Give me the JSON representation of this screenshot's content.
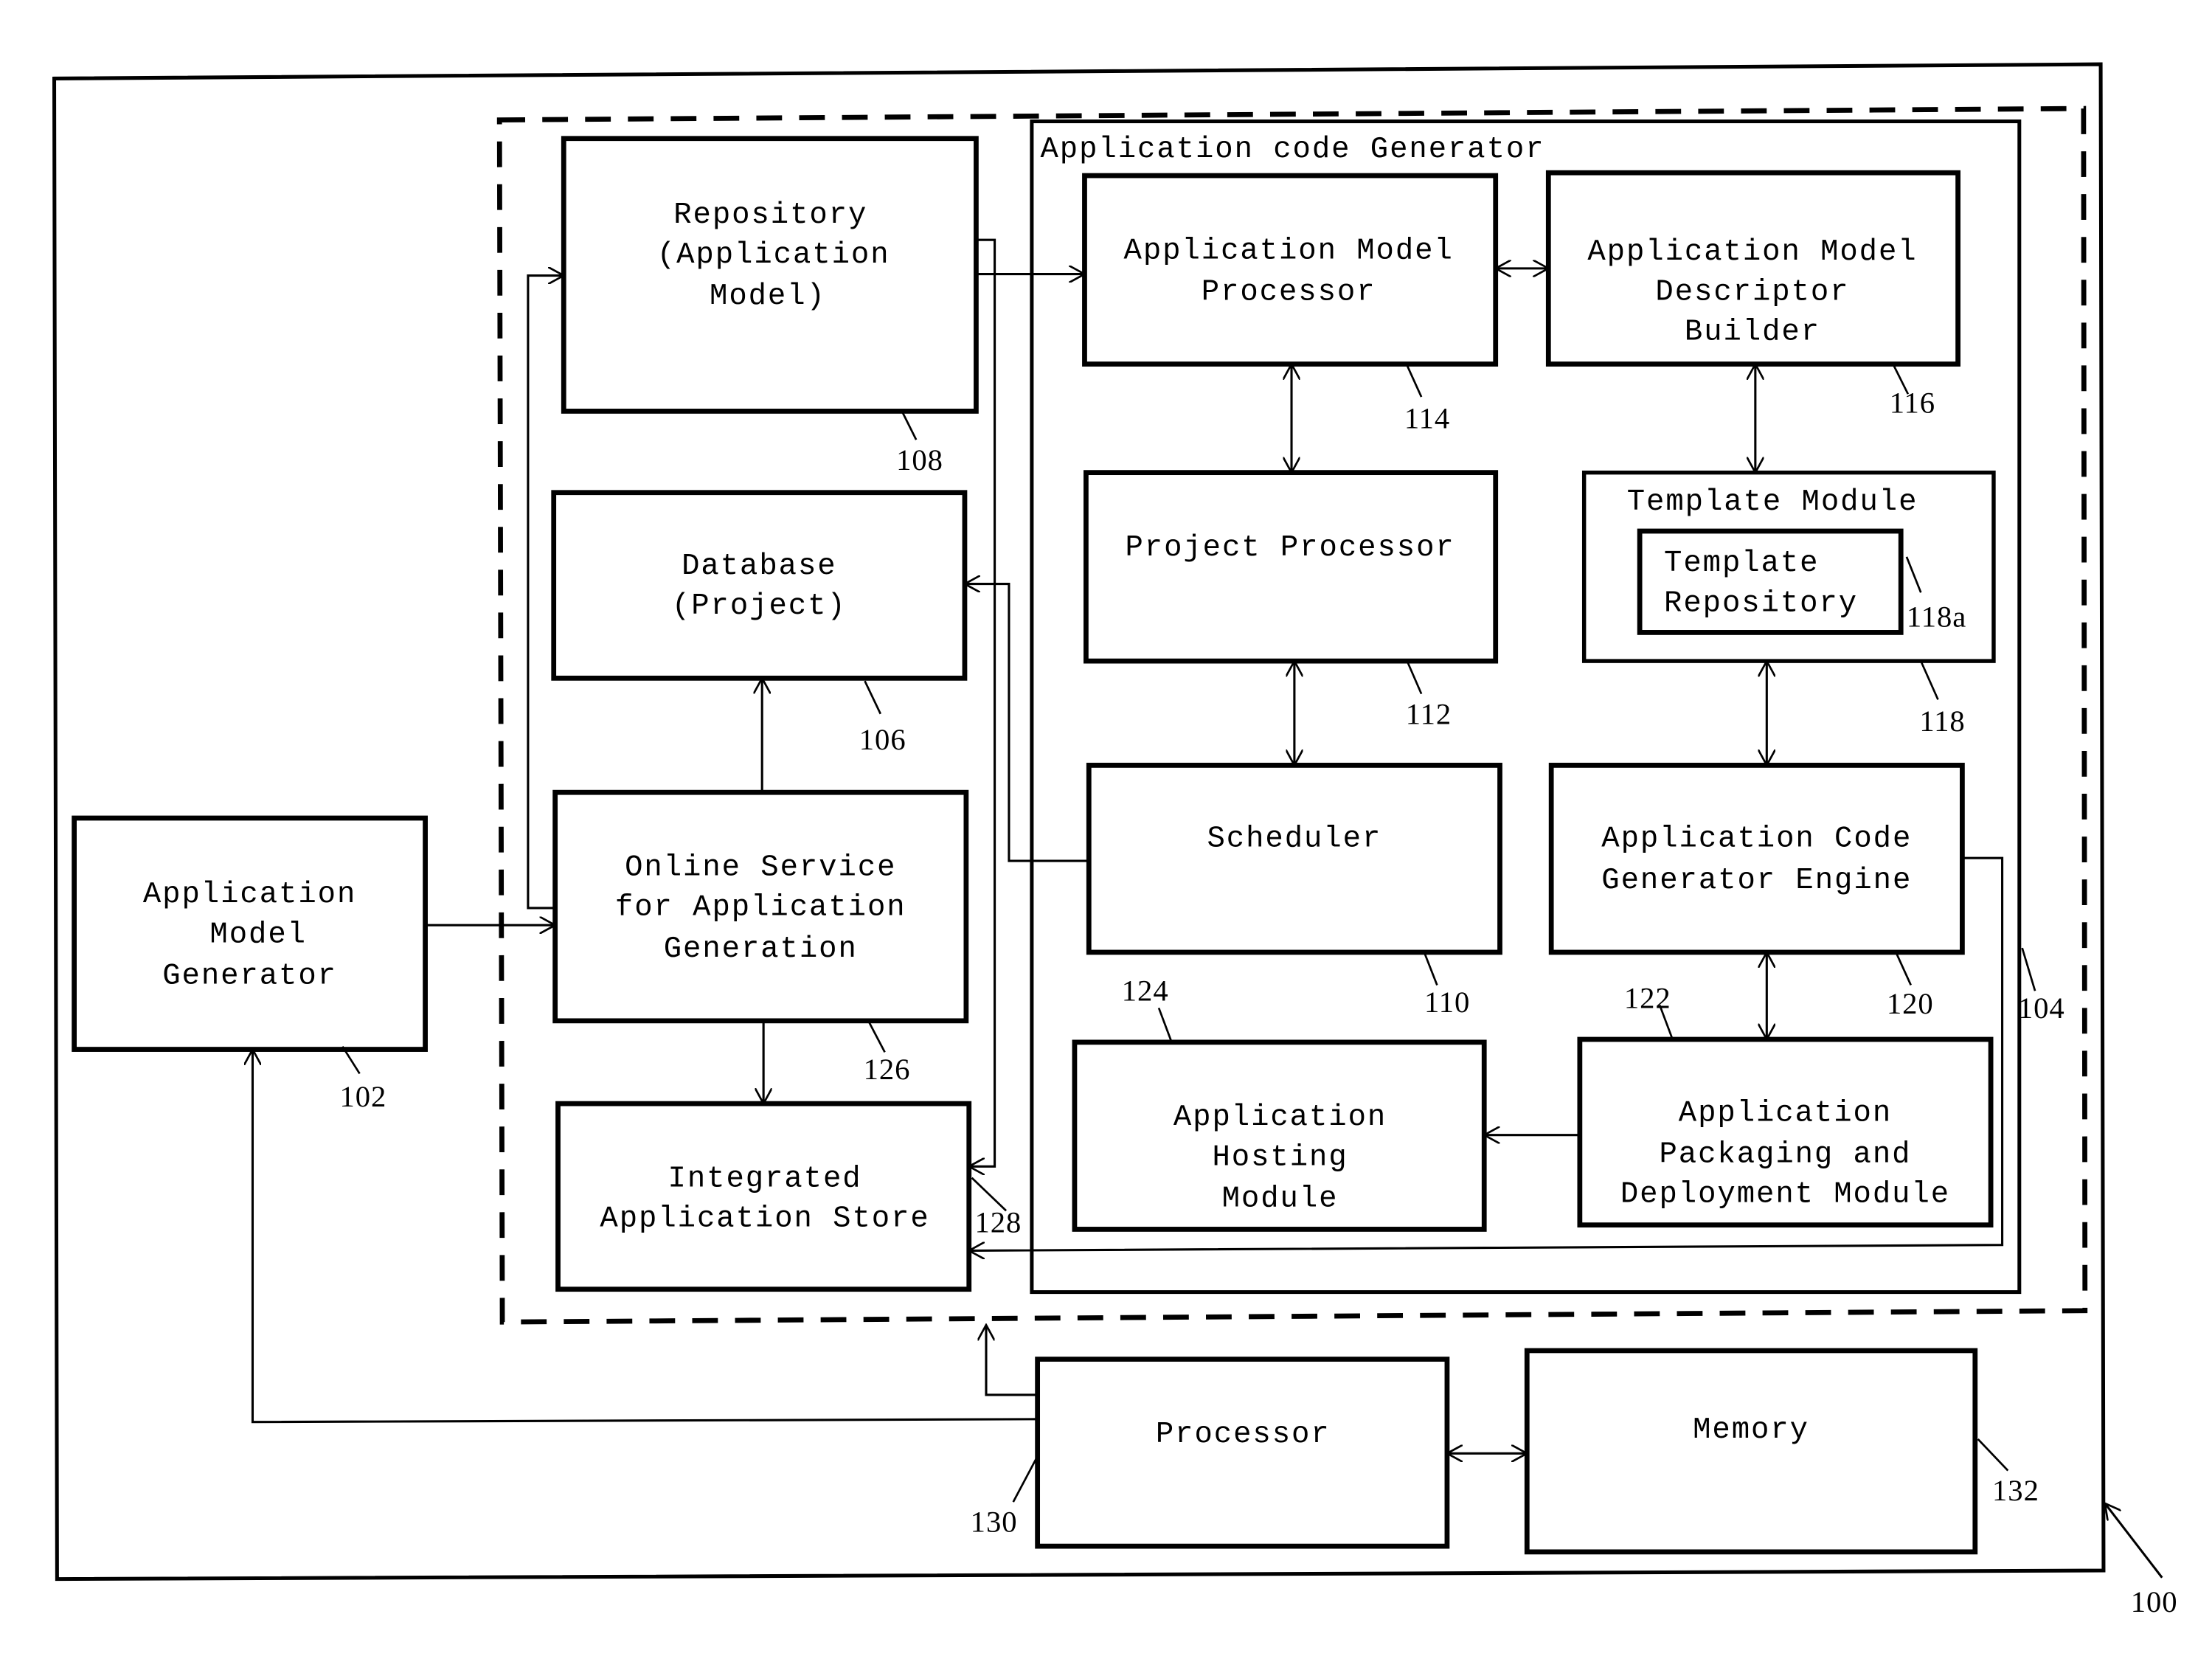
{
  "diagram": {
    "system_ref": "100",
    "container_ref": "104",
    "inner_container": {
      "label": "Application code Generator",
      "ref": "104"
    },
    "blocks": {
      "app_model_generator": {
        "lines": [
          "Application",
          "Model",
          "Generator"
        ],
        "ref": "102"
      },
      "repository": {
        "lines": [
          "Repository",
          "(Application",
          "Model)"
        ],
        "ref": "108"
      },
      "database": {
        "lines": [
          "Database",
          "(Project)"
        ],
        "ref": "106"
      },
      "online_service": {
        "lines": [
          "Online Service",
          "for Application",
          "Generation"
        ],
        "ref": "126"
      },
      "integrated_store": {
        "lines": [
          "Integrated",
          "Application Store"
        ],
        "ref": "128"
      },
      "app_model_processor": {
        "lines": [
          "Application Model",
          "Processor"
        ],
        "ref": "114"
      },
      "descriptor_builder": {
        "lines": [
          "Application Model",
          "Descriptor",
          "Builder"
        ],
        "ref": "116"
      },
      "project_processor": {
        "lines": [
          "Project Processor"
        ],
        "ref": "112"
      },
      "template_module": {
        "lines": [
          "Template Module"
        ],
        "ref": "118"
      },
      "template_repository": {
        "lines": [
          "Template",
          "Repository"
        ],
        "ref": "118a"
      },
      "scheduler": {
        "lines": [
          "Scheduler"
        ],
        "ref": "110"
      },
      "code_generator_engine": {
        "lines": [
          "Application Code",
          "Generator Engine"
        ],
        "ref": "120"
      },
      "hosting_module": {
        "lines": [
          "Application",
          "Hosting",
          "Module"
        ],
        "ref": "124"
      },
      "packaging_module": {
        "lines": [
          "Application",
          "Packaging and",
          "Deployment Module"
        ],
        "ref": "122"
      },
      "processor": {
        "lines": [
          "Processor"
        ],
        "ref": "130"
      },
      "memory": {
        "lines": [
          "Memory"
        ],
        "ref": "132"
      }
    }
  }
}
